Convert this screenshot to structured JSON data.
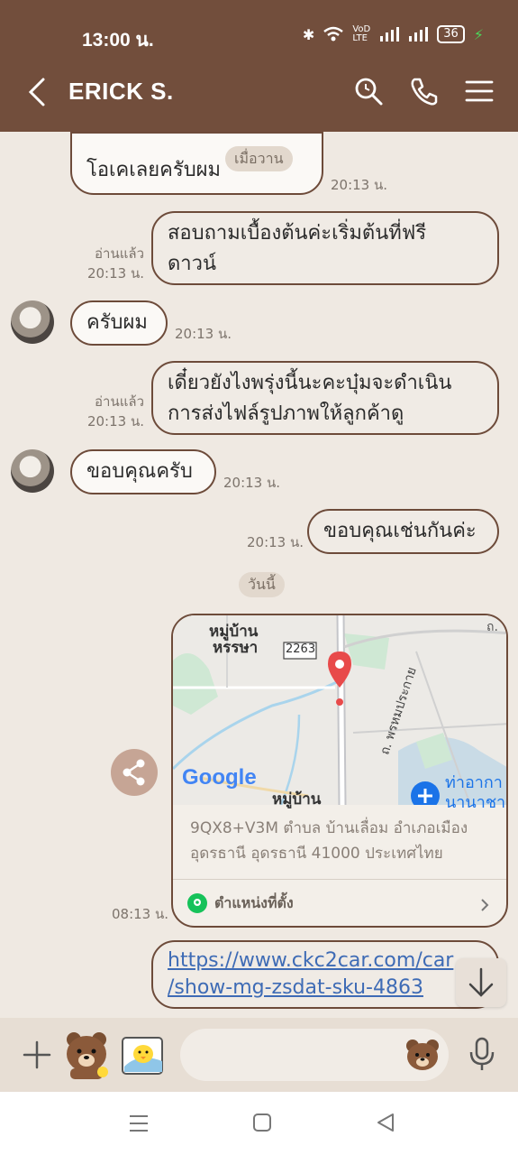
{
  "status_bar": {
    "time": "13:00 น.",
    "battery": "36"
  },
  "header": {
    "title": "ERICK S."
  },
  "messages": {
    "m1": {
      "text": "โอเคเลยครับผม",
      "time": "20:13 น.",
      "chip": "เมื่อวาน"
    },
    "m2": {
      "line1": "สอบถามเบื้องต้นค่ะเริ่มต้นที่ฟรี",
      "line2": "ดาวน์",
      "read": "อ่านแล้ว",
      "time": "20:13 น."
    },
    "m3": {
      "text": "ครับผม",
      "time": "20:13 น."
    },
    "m4": {
      "line1": "เดี๋ยวยังไงพรุ่งนี้นะคะบุ๋มจะดำเนิน",
      "line2": "การส่งไฟล์รูปภาพให้ลูกค้าดู",
      "read": "อ่านแล้ว",
      "time": "20:13 น."
    },
    "m5": {
      "text": "ขอบคุณครับ",
      "time": "20:13 น."
    },
    "m6": {
      "text": "ขอบคุณเช่นกันค่ะ",
      "time": "20:13 น."
    },
    "date_divider": "วันนี้",
    "location": {
      "map_labels": {
        "village1_l1": "หมู่บ้าน",
        "village1_l2": "หรรษา",
        "route": "2263",
        "road": "ถ. พรหมประกาย",
        "village2": "หมู่บ้าน",
        "airport_l1": "ท่าอากา",
        "airport_l2": "นานาชา",
        "google": "Google",
        "corner": "ถ."
      },
      "address_l1": "9QX8+V3M ตำบล บ้านเลื่อม อำเภอเมือง",
      "address_l2": "อุดรธานี อุดรธานี 41000 ประเทศไทย",
      "label": "ตำแหน่งที่ตั้ง",
      "time": "08:13 น."
    },
    "link": {
      "line1": "https://www.ckc2car.com/car",
      "line2": "/show-mg-zsdat-sku-4863"
    }
  },
  "input": {
    "placeholder": ""
  },
  "colors": {
    "header": "#724e3c",
    "bubble_border": "#6d4b3a",
    "background": "#efe9e2",
    "link": "#3e6bb5",
    "pin": "#e84a4a"
  }
}
